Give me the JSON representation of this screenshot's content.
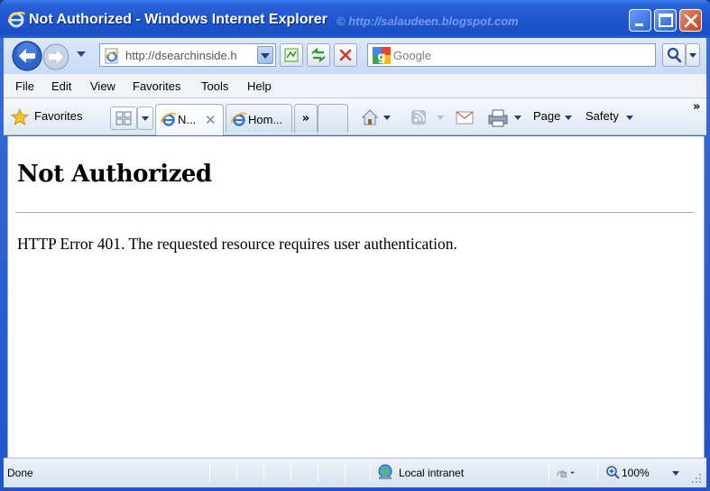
{
  "window": {
    "title": "Not Authorized - Windows Internet Explorer",
    "watermark": "© http://salaudeen.blogspot.com"
  },
  "address_bar": {
    "url": "http://dsearchinside.h",
    "search_placeholder": "Google"
  },
  "menu": {
    "items": [
      "File",
      "Edit",
      "View",
      "Favorites",
      "Tools",
      "Help"
    ]
  },
  "favorites_bar": {
    "favorites_label": "Favorites",
    "tabs": [
      {
        "label": "N...",
        "active": true
      },
      {
        "label": "Hom...",
        "active": false
      }
    ],
    "tab_list_label": "»",
    "page_label": "Page",
    "safety_label": "Safety",
    "overflow_label": "»"
  },
  "page": {
    "heading": "Not Authorized",
    "message": "HTTP Error 401. The requested resource requires user authentication."
  },
  "status_bar": {
    "status": "Done",
    "zone": "Local intranet",
    "zoom": "100%"
  },
  "colors": {
    "titlebar": "#2054c9",
    "close_button": "#c8401c",
    "content_bg": "#ffffff"
  }
}
